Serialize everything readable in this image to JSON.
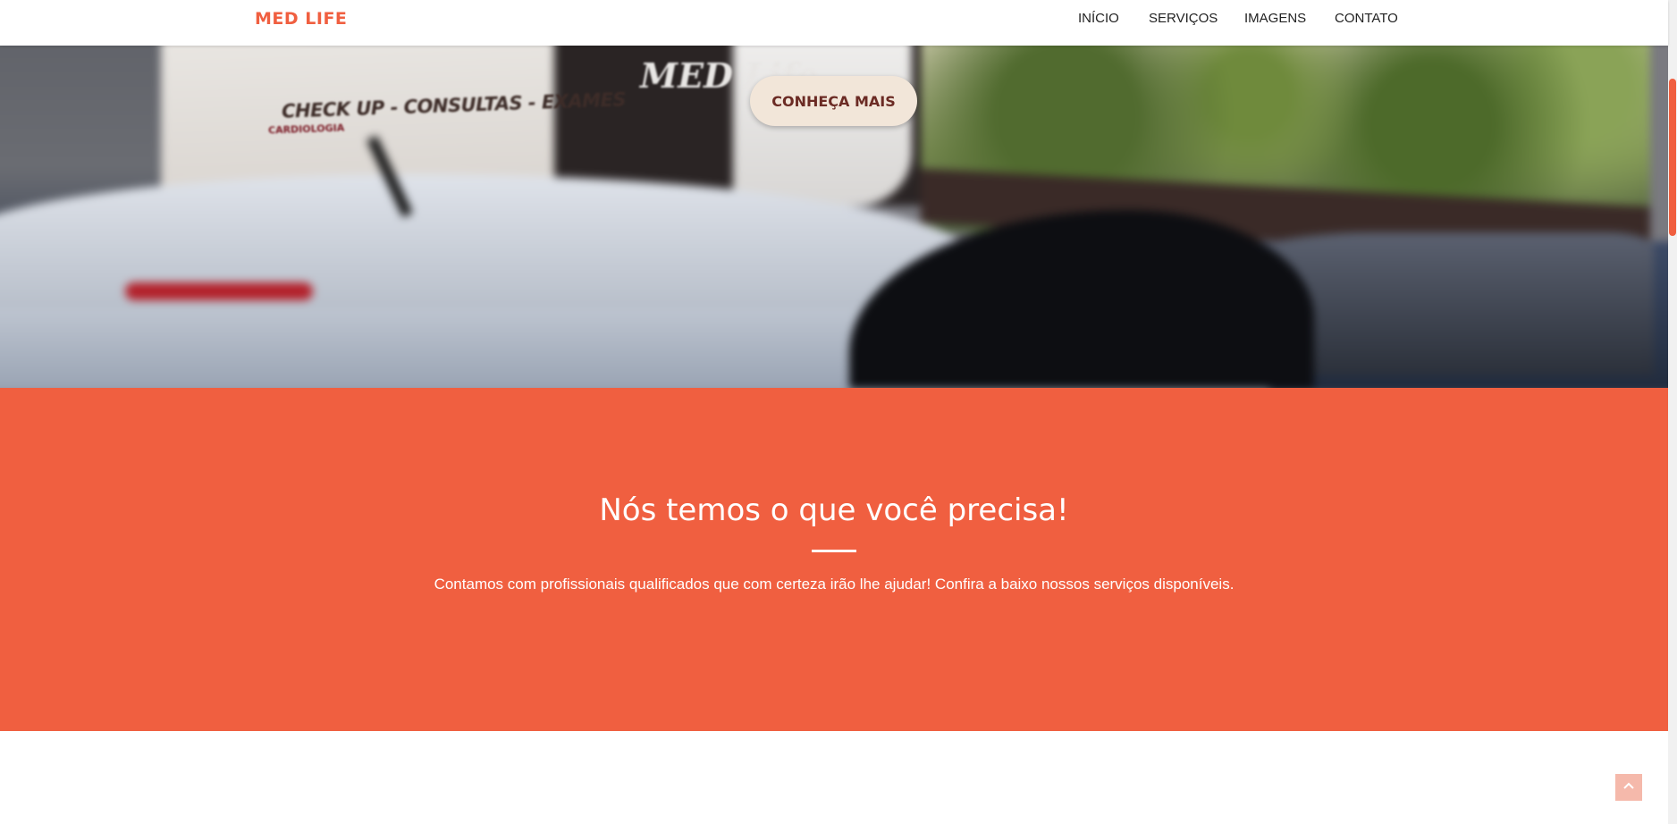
{
  "navbar": {
    "brand": "MED LIFE",
    "links": [
      "INÍCIO",
      "SERVIÇOS",
      "IMAGENS",
      "CONTATO"
    ]
  },
  "hero": {
    "cta_label": "CONHEÇA MAIS",
    "sign_text": "CHECK UP - CONSULTAS - EXAMES",
    "sign_sub": "CARDIOLOGIA",
    "sign_logo": "MED Life"
  },
  "services": {
    "heading": "Nós temos o que você precisa!",
    "description": "Contamos com profissionais qualificados que com certeza irão lhe ajudar! Confira a baixo nossos serviços disponíveis."
  },
  "icons": {
    "back_to_top": "chevron-up-icon"
  },
  "colors": {
    "accent": "#f05f40",
    "cta_bg": "#f2e6d9",
    "cta_text": "#6b2b24",
    "back_to_top_bg": "#f5b9ab"
  }
}
